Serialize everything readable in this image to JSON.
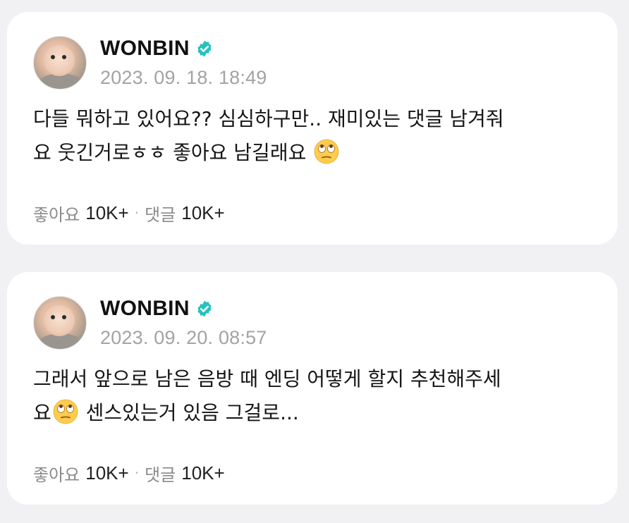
{
  "posts": [
    {
      "author": "WONBIN",
      "timestamp": "2023. 09. 18. 18:49",
      "text_line1": "다들 뭐하고 있어요?? 심심하구만.. 재미있는 댓글 남겨줘",
      "text_line2": "요 웃긴거로ㅎㅎ 좋아요 남길래요",
      "emoji": "face-with-rolling-eyes",
      "like_label": "좋아요",
      "like_count": "10K+",
      "separator": "·",
      "comment_label": "댓글",
      "comment_count": "10K+"
    },
    {
      "author": "WONBIN",
      "timestamp": "2023. 09. 20. 08:57",
      "text_line1": "그래서 앞으로 남은 음방 때 엔딩 어떻게 할지 추천해주세",
      "text_line2_prefix": "요",
      "text_line2_suffix": " 센스있는거 있음 그걸로...",
      "emoji": "face-with-rolling-eyes",
      "like_label": "좋아요",
      "like_count": "10K+",
      "separator": "·",
      "comment_label": "댓글",
      "comment_count": "10K+"
    }
  ],
  "colors": {
    "verified_badge": "#22c2bf",
    "page_background": "#f1f1f3",
    "card_background": "#ffffff",
    "muted_text": "#a3a3a3"
  },
  "icons": {
    "verified": "verified-badge-icon",
    "emoji": "rolling-eyes-emoji-icon"
  }
}
